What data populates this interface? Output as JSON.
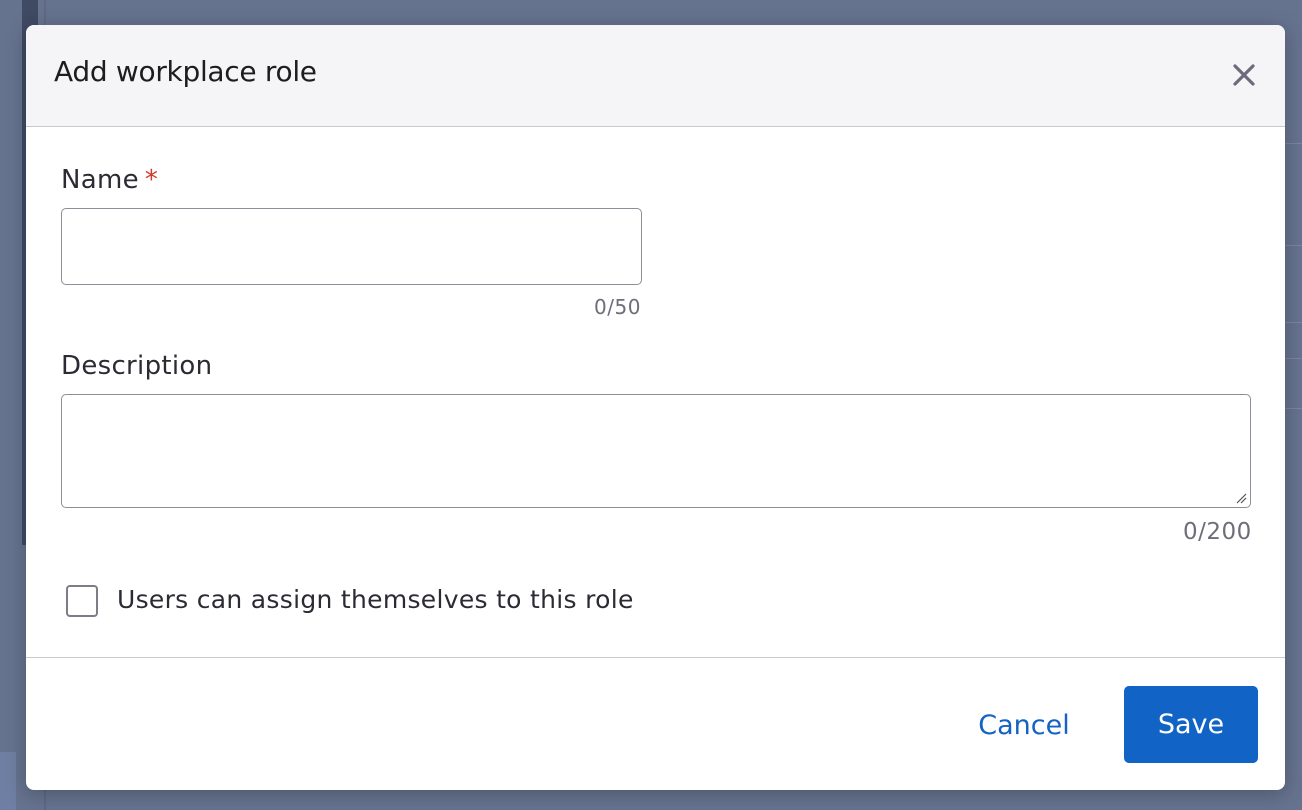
{
  "colors": {
    "overlay": "#66738f",
    "header_bg": "#f5f5f8",
    "required_marker": "#d13a26",
    "link_blue": "#1463c4",
    "primary_button": "#1163c6"
  },
  "dialog": {
    "title": "Add workplace role",
    "close_icon": "close-icon"
  },
  "form": {
    "name": {
      "label": "Name",
      "required_marker": "*",
      "value": "",
      "counter": "0/50"
    },
    "description": {
      "label": "Description",
      "value": "",
      "counter": "0/200"
    },
    "self_assign": {
      "label": "Users can assign themselves to this role",
      "checked": false
    }
  },
  "footer": {
    "cancel_label": "Cancel",
    "save_label": "Save"
  }
}
